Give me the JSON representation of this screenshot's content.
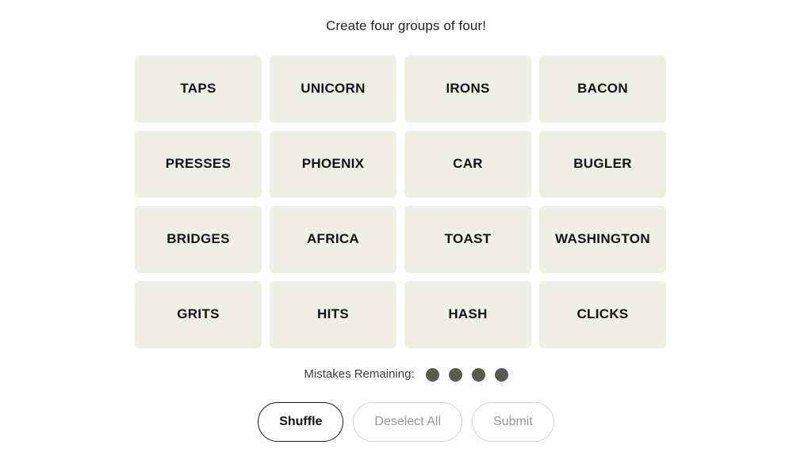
{
  "header": {
    "title": "Create four groups of four!"
  },
  "grid": {
    "rows": 4,
    "columns": 4,
    "tiles": [
      {
        "label": "TAPS"
      },
      {
        "label": "UNICORN"
      },
      {
        "label": "IRONS"
      },
      {
        "label": "BACON"
      },
      {
        "label": "PRESSES"
      },
      {
        "label": "PHOENIX"
      },
      {
        "label": "CAR"
      },
      {
        "label": "BUGLER"
      },
      {
        "label": "BRIDGES"
      },
      {
        "label": "AFRICA"
      },
      {
        "label": "TOAST"
      },
      {
        "label": "WASHINGTON"
      },
      {
        "label": "GRITS"
      },
      {
        "label": "HITS"
      },
      {
        "label": "HASH"
      },
      {
        "label": "CLICKS"
      }
    ]
  },
  "mistakes": {
    "label": "Mistakes Remaining:",
    "remaining": 4,
    "dot_color": "#5a5a4e"
  },
  "controls": {
    "shuffle": {
      "label": "Shuffle",
      "state": "enabled"
    },
    "deselect_all": {
      "label": "Deselect All",
      "state": "disabled"
    },
    "submit": {
      "label": "Submit",
      "state": "disabled"
    }
  },
  "colors": {
    "page_background": "#ffffff",
    "tile_background": "#efefe6",
    "tile_text": "#121212",
    "title_text": "#232323",
    "mistake_dot": "#5a5a4e",
    "enabled_border": "#1a1a1a",
    "disabled_border": "#d3d3d3",
    "disabled_text": "#989898"
  }
}
